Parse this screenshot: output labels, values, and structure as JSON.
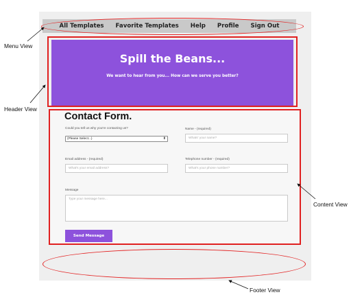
{
  "menu": {
    "items": [
      "All Templates",
      "Favorite Templates",
      "Help",
      "Profile",
      "Sign Out"
    ]
  },
  "header": {
    "title": "Spill the Beans...",
    "subtitle": "We want to hear from you... How can we serve you better?"
  },
  "form": {
    "title": "Contact Form.",
    "reason_label": "Could you tell us why you're contacting us?",
    "reason_value": "(Please Select...)",
    "name_label": "Name - (required)",
    "name_placeholder": "Whats' your name?",
    "email_label": "Email address - (required)",
    "email_placeholder": "What's your email address?",
    "phone_label": "Telephone number - (required)",
    "phone_placeholder": "What's your phone number?",
    "message_label": "Message",
    "message_placeholder": "Type your message here...",
    "send_label": "Send Message"
  },
  "annotations": {
    "menu_view": "Menu View",
    "header_view": "Header View",
    "content_view": "Content View",
    "footer_view": "Footer View"
  },
  "colors": {
    "accent": "#8d52dc",
    "annotation_red": "#e01f1f"
  }
}
